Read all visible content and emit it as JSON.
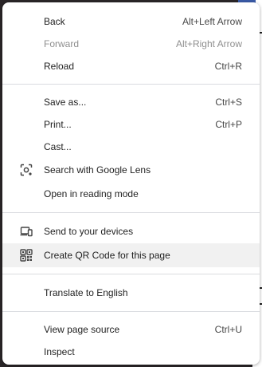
{
  "menu": {
    "groups": [
      [
        {
          "label": "Back",
          "shortcut": "Alt+Left Arrow",
          "disabled": false
        },
        {
          "label": "Forward",
          "shortcut": "Alt+Right Arrow",
          "disabled": true
        },
        {
          "label": "Reload",
          "shortcut": "Ctrl+R",
          "disabled": false
        }
      ],
      [
        {
          "label": "Save as...",
          "shortcut": "Ctrl+S"
        },
        {
          "label": "Print...",
          "shortcut": "Ctrl+P"
        },
        {
          "label": "Cast...",
          "shortcut": ""
        },
        {
          "label": "Search with Google Lens",
          "shortcut": "",
          "icon": "google-lens-icon"
        },
        {
          "label": "Open in reading mode",
          "shortcut": ""
        }
      ],
      [
        {
          "label": "Send to your devices",
          "shortcut": "",
          "icon": "send-to-devices-icon"
        },
        {
          "label": "Create QR Code for this page",
          "shortcut": "",
          "icon": "qr-code-icon",
          "hovered": true
        }
      ],
      [
        {
          "label": "Translate to English",
          "shortcut": ""
        }
      ],
      [
        {
          "label": "View page source",
          "shortcut": "Ctrl+U"
        },
        {
          "label": "Inspect",
          "shortcut": ""
        }
      ]
    ]
  }
}
